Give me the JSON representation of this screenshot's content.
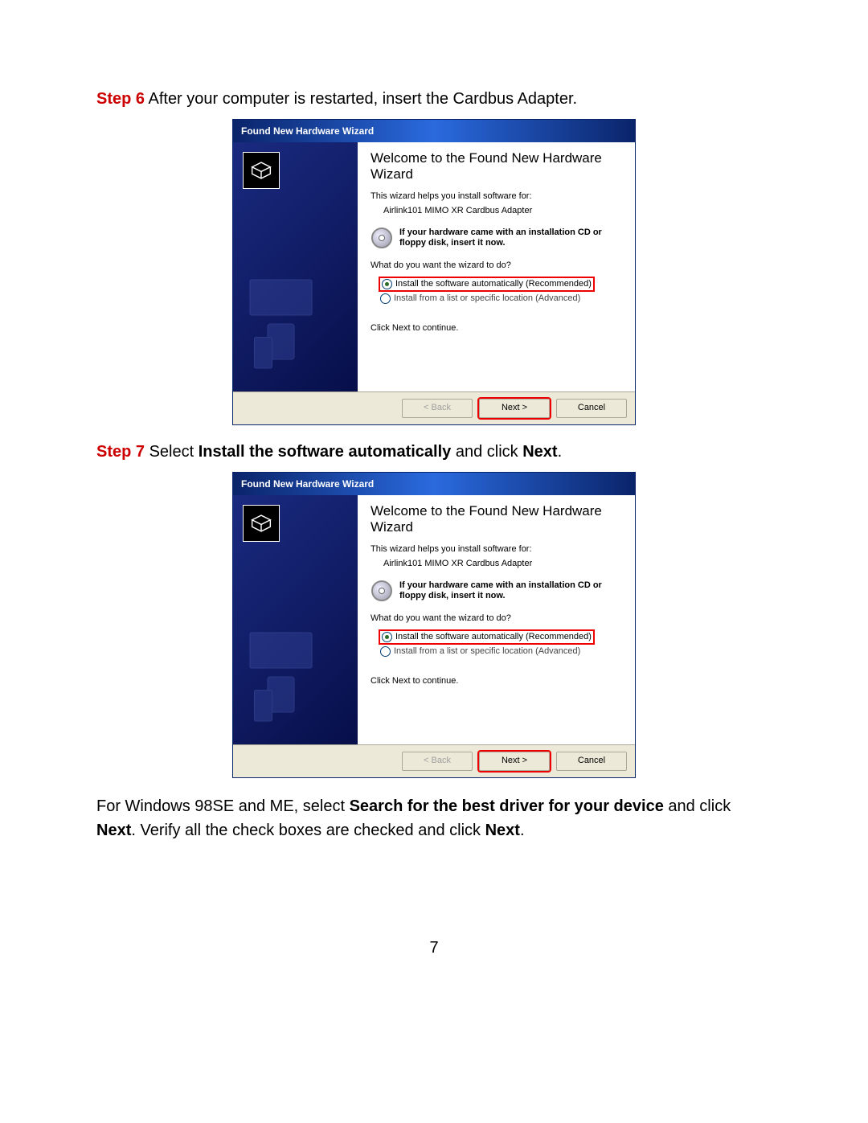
{
  "step6": {
    "label": "Step 6",
    "text": " After your computer is restarted, insert the Cardbus Adapter."
  },
  "step7": {
    "label": "Step 7",
    "text_pre": " Select ",
    "bold1": "Install the software automatically",
    "text_mid": " and click ",
    "bold2": "Next",
    "text_post": "."
  },
  "note": {
    "pre": "For Windows 98SE and ME, select ",
    "b1": "Search for the best driver for your device",
    "mid1": " and click ",
    "b2": "Next",
    "mid2": ". Verify all the check boxes are checked and click ",
    "b3": "Next",
    "post": "."
  },
  "wizard": {
    "title": "Found New Hardware Wizard",
    "heading": "Welcome to the Found New Hardware Wizard",
    "help_text": "This wizard helps you install software for:",
    "device": "Airlink101 MIMO XR Cardbus Adapter",
    "cd_text": "If your hardware came with an installation CD or floppy disk, insert it now.",
    "question": "What do you want the wizard to do?",
    "opt1": "Install the software automatically (Recommended)",
    "opt2": "Install from a list or specific location (Advanced)",
    "continue": "Click Next to continue.",
    "buttons": {
      "back": "< Back",
      "next": "Next >",
      "cancel": "Cancel"
    }
  },
  "page_number": "7"
}
